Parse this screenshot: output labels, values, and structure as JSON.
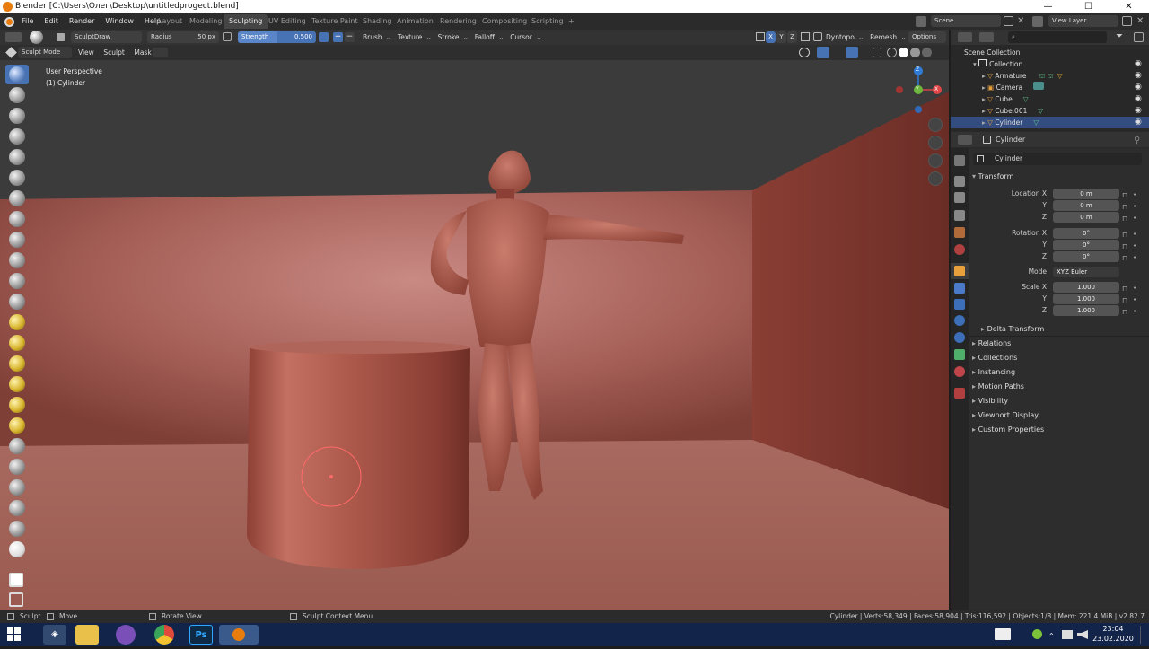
{
  "window": {
    "title": "Blender [C:\\Users\\Олег\\Desktop\\untitledprogect.blend]",
    "min": "—",
    "max": "☐",
    "close": "✕"
  },
  "topbar": {
    "menus": [
      "File",
      "Edit",
      "Render",
      "Window",
      "Help"
    ],
    "workspaces": [
      {
        "label": "Layout"
      },
      {
        "label": "Modeling"
      },
      {
        "label": "Sculpting",
        "active": true
      },
      {
        "label": "UV Editing"
      },
      {
        "label": "Texture Paint"
      },
      {
        "label": "Shading"
      },
      {
        "label": "Animation"
      },
      {
        "label": "Rendering"
      },
      {
        "label": "Compositing"
      },
      {
        "label": "Scripting"
      }
    ],
    "add_tab": "+",
    "scene": "Scene",
    "view_layer": "View Layer"
  },
  "toolheader": {
    "brush_name": "SculptDraw",
    "radius_label": "Radius",
    "radius_value": "50 px",
    "strength_label": "Strength",
    "strength_value": "0.500",
    "plus": "+",
    "minus": "−",
    "brush": "Brush",
    "texture": "Texture",
    "stroke": "Stroke",
    "falloff": "Falloff",
    "cursor": "Cursor",
    "axis_x": "X",
    "axis_y": "Y",
    "axis_z": "Z",
    "dyntopo": "Dyntopo",
    "remesh": "Remesh",
    "options": "Options"
  },
  "modeheader": {
    "mode": "Sculpt Mode",
    "view": "View",
    "sculpt": "Sculpt",
    "mask": "Mask"
  },
  "viewport": {
    "perspective": "User Perspective",
    "object": "(1) Cylinder",
    "gizmo_x": "X",
    "gizmo_y": "Y",
    "gizmo_z": "Z"
  },
  "outliner": {
    "search_placeholder": "",
    "root": "Scene Collection",
    "collection": "Collection",
    "items": [
      {
        "label": "Armature"
      },
      {
        "label": "Camera"
      },
      {
        "label": "Cube"
      },
      {
        "label": "Cube.001"
      },
      {
        "label": "Cylinder",
        "selected": true
      }
    ]
  },
  "properties": {
    "object_name": "Cylinder",
    "datablock_name": "Cylinder",
    "transform_title": "Transform",
    "location": {
      "label": "Location X",
      "x": "0 m",
      "y": "0 m",
      "z": "0 m"
    },
    "rotation": {
      "label": "Rotation X",
      "x": "0°",
      "y": "0°",
      "z": "0°"
    },
    "axis_y": "Y",
    "axis_z": "Z",
    "mode_label": "Mode",
    "mode_value": "XYZ Euler",
    "scale": {
      "label": "Scale X",
      "x": "1.000",
      "y": "1.000",
      "z": "1.000"
    },
    "delta_transform": "Delta Transform",
    "sections": [
      "Relations",
      "Collections",
      "Instancing",
      "Motion Paths",
      "Visibility",
      "Viewport Display",
      "Custom Properties"
    ]
  },
  "statusbar": {
    "left1": "Sculpt",
    "left2": "Move",
    "left3": "Rotate View",
    "left4": "Sculpt Context Menu",
    "stats": "Cylinder | Verts:58,349 | Faces:58,904 | Tris:116,592 | Objects:1/8 | Mem: 221.4 MiB | v2.82.7"
  },
  "taskbar": {
    "time": "23:04",
    "date": "23.02.2020",
    "ps_label": "Ps"
  },
  "colors": {
    "accent": "#4772b3",
    "blender_orange": "#e87d0d",
    "selection": "#334d80"
  }
}
